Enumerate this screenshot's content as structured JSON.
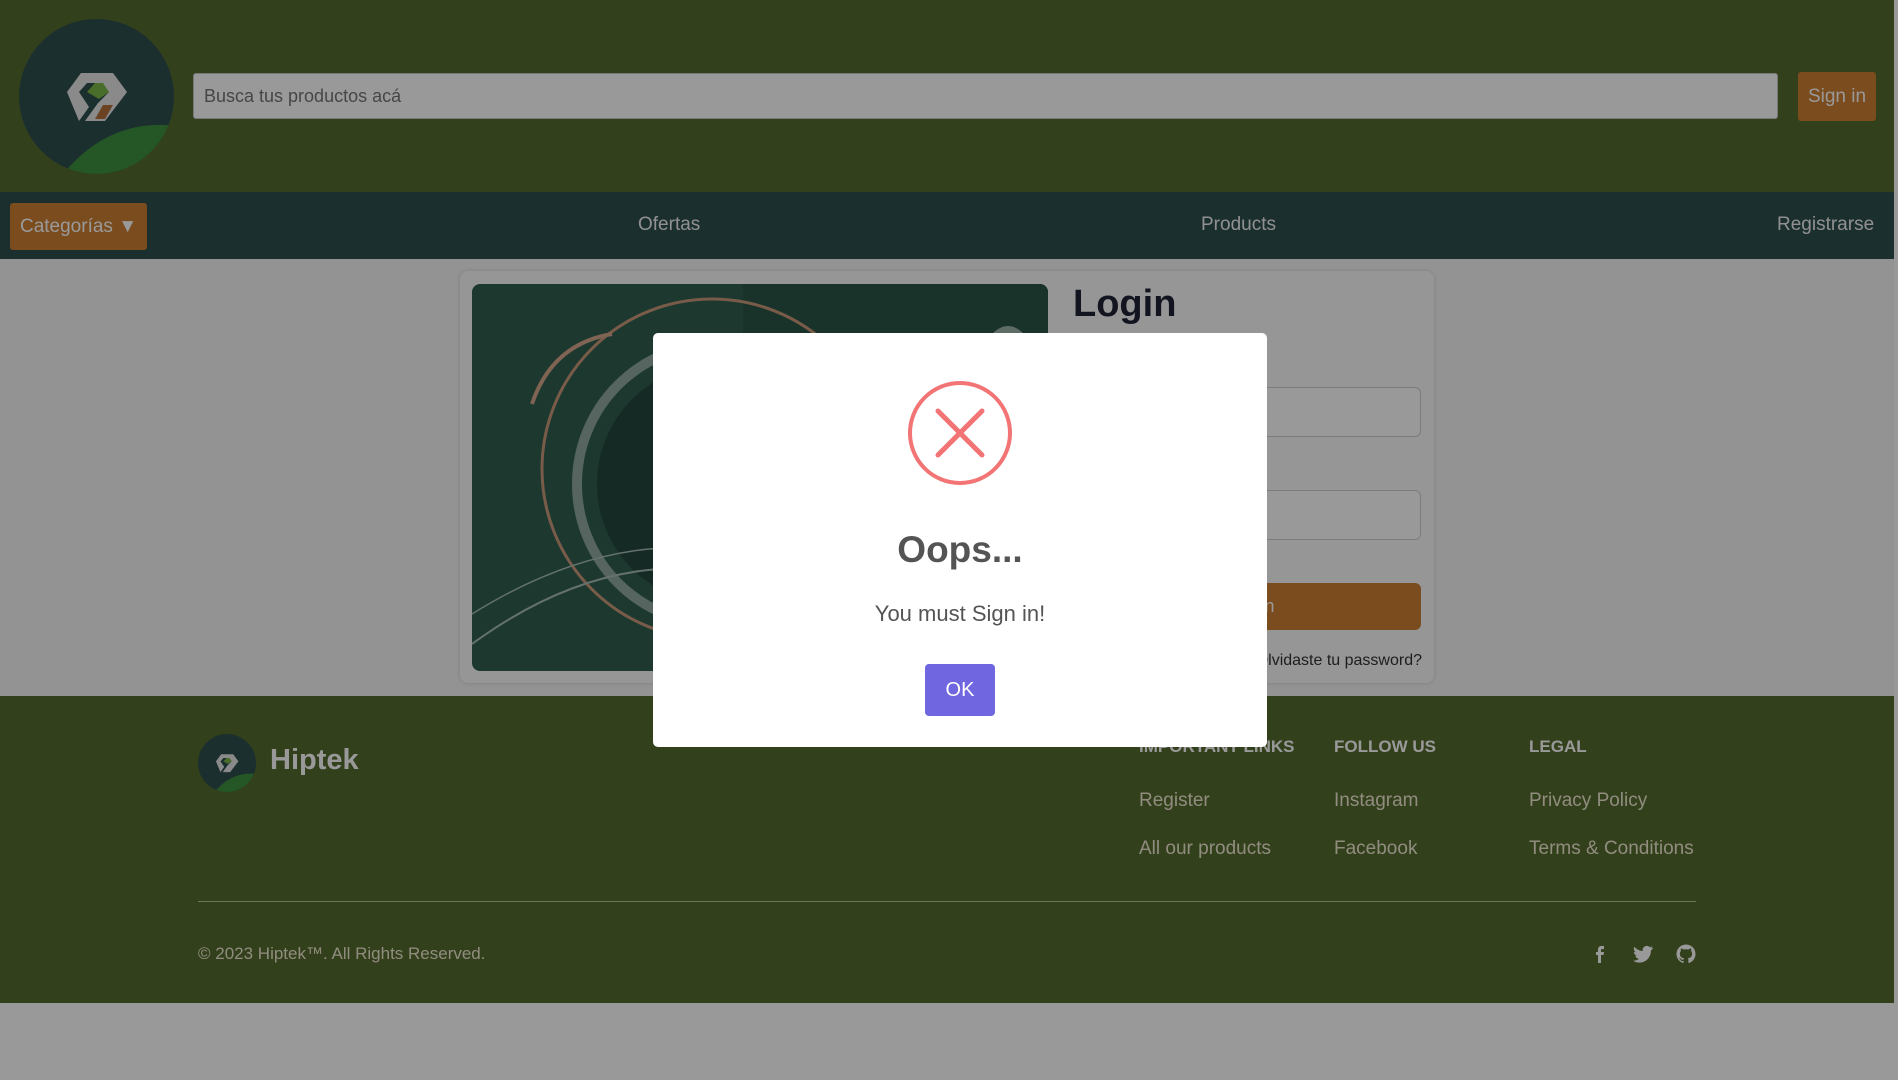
{
  "header": {
    "search_placeholder": "Busca tus productos acá",
    "signin_label": "Sign in"
  },
  "nav": {
    "categories_label": "Categorías ▼",
    "links": [
      "Ofertas",
      "Products",
      "Registrarse"
    ]
  },
  "login": {
    "title": "Login",
    "submit_label": "Sign in",
    "forgot_label": "¿Olvidaste tu password?"
  },
  "footer": {
    "brand": "Hiptek",
    "columns": [
      {
        "title": "IMPORTANT LINKS",
        "links": [
          "Register",
          "All our products"
        ]
      },
      {
        "title": "FOLLOW US",
        "links": [
          "Instagram",
          "Facebook"
        ]
      },
      {
        "title": "LEGAL",
        "links": [
          "Privacy Policy",
          "Terms & Conditions"
        ]
      }
    ],
    "copyright": "© 2023 Hiptek™. All Rights Reserved.",
    "social_icons": [
      "facebook-icon",
      "twitter-icon",
      "github-icon"
    ]
  },
  "modal": {
    "title": "Oops...",
    "text": "You must Sign in!",
    "ok_label": "OK",
    "icon": "error-x-icon"
  },
  "colors": {
    "header_bg": "#556b2f",
    "nav_bg": "#2f4f4f",
    "accent": "#cd7f32",
    "modal_button": "#7066e0",
    "error_red": "#f27474"
  }
}
